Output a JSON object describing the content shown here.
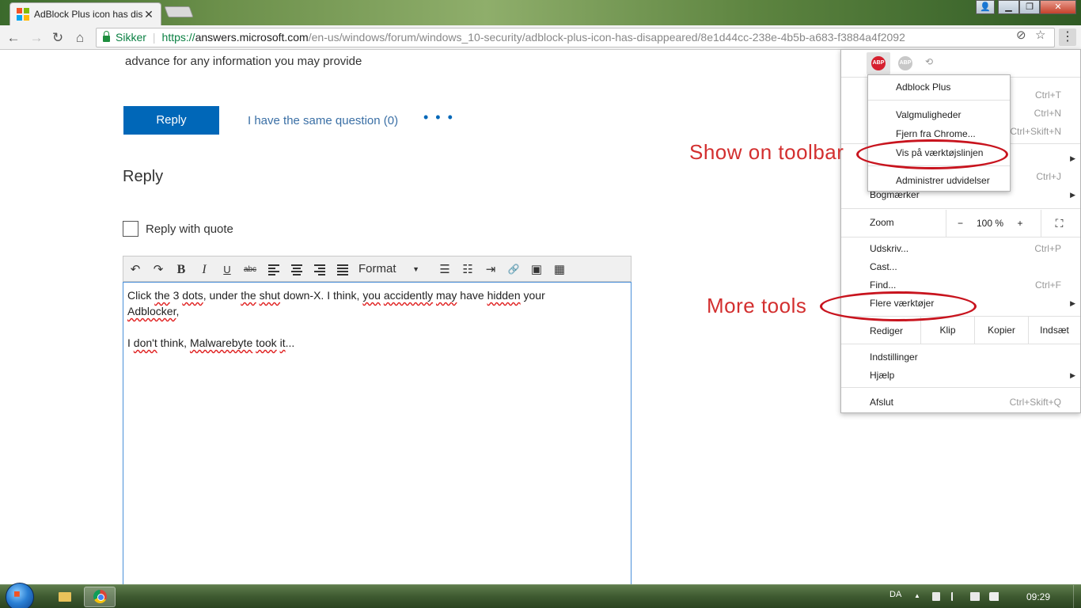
{
  "browser": {
    "tab_title": "AdBlock Plus icon has dis",
    "tab_close": "✕",
    "window_controls": {
      "user": "👤",
      "minimize": "▁",
      "maximize": "❐",
      "close": "✕"
    },
    "secure_label": "Sikker",
    "url_scheme": "https://",
    "url_host": "answers.microsoft.com",
    "url_path": "/en-us/windows/forum/windows_10-security/adblock-plus-icon-has-disappeared/8e1d44cc-238e-4b5b-a683-f3884a4f2092",
    "menu_button": "⋮"
  },
  "page": {
    "intro_text": "advance for any information you may provide",
    "reply_button": "Reply",
    "same_question": "I have the same question (0)",
    "more_options": "• • •",
    "reply_heading": "Reply",
    "reply_with_quote": "Reply with quote",
    "reply_with_quote_checked": false,
    "editor_toolbar": {
      "undo": "↶",
      "redo": "↷",
      "bold": "B",
      "italic": "I",
      "underline": "U",
      "strike": "abc",
      "format_label": "Format",
      "format_caret": "▼",
      "bullet_list": "☰",
      "numbered_list": "☷",
      "indent": "⇥",
      "link": "🔗",
      "image": "▣",
      "table": "▦"
    },
    "editor_lines": [
      [
        "Click ",
        "the",
        " 3 ",
        "dots",
        ", under ",
        "the",
        " ",
        "shut",
        " down-X. I think, ",
        "you",
        " ",
        "accidently",
        " ",
        "may",
        " have ",
        "hidden",
        " your"
      ],
      [
        "Adblocker",
        ","
      ],
      [
        "I ",
        "don't",
        " think, ",
        "Malwarebyte",
        " ",
        "took",
        " ",
        "it",
        "..."
      ]
    ]
  },
  "chrome_menu": {
    "extensions": {
      "abp_icon": "ABP",
      "gray_icon": "ABP",
      "cast_icon": "⟲"
    },
    "shortcuts": [
      "Ctrl+T",
      "Ctrl+N",
      "Ctrl+Skift+N",
      "Ctrl+J"
    ],
    "bookmarks": "Bogmærker",
    "zoom_label": "Zoom",
    "zoom_minus": "−",
    "zoom_value": "100 %",
    "zoom_plus": "+",
    "fullscreen": "⛶",
    "print": "Udskriv...",
    "print_shortcut": "Ctrl+P",
    "cast": "Cast...",
    "find": "Find...",
    "find_shortcut": "Ctrl+F",
    "more_tools": "Flere værktøjer",
    "edit_label": "Rediger",
    "cut": "Klip",
    "copy": "Kopier",
    "paste": "Indsæt",
    "settings": "Indstillinger",
    "help": "Hjælp",
    "exit": "Afslut",
    "exit_shortcut": "Ctrl+Skift+Q",
    "submenu_arrow": "▶"
  },
  "extension_menu": {
    "title": "Adblock Plus",
    "options": "Valgmuligheder",
    "remove": "Fjern fra Chrome...",
    "show_on_toolbar": "Vis på værktøjslinjen",
    "manage": "Administrer udvidelser"
  },
  "annotations": {
    "show_on_toolbar": "Show on toolbar",
    "more_tools": "More tools",
    "color": "#d32f2f"
  },
  "taskbar": {
    "language": "DA",
    "tray_arrow": "▲",
    "time": "09:29"
  }
}
